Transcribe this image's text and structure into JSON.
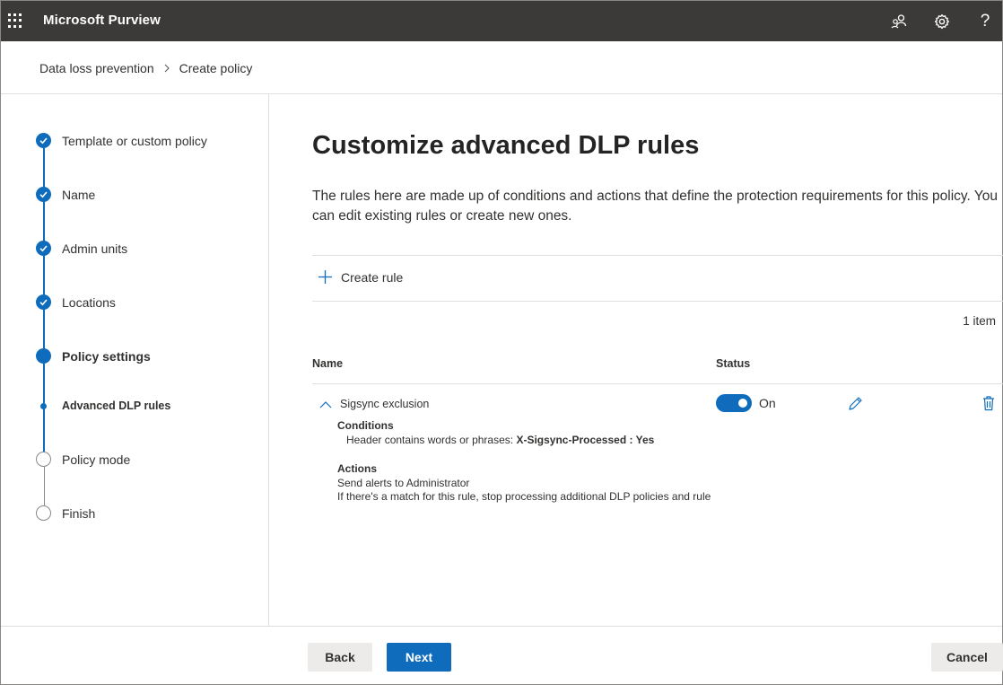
{
  "app": {
    "title": "Microsoft Purview"
  },
  "topbar_icons": [
    "waffle-icon",
    "community-icon",
    "gear-icon",
    "help-icon"
  ],
  "help_glyph": "?",
  "breadcrumb": {
    "items": [
      "Data loss prevention",
      "Create policy"
    ]
  },
  "steps": [
    {
      "label": "Template or custom policy",
      "state": "done"
    },
    {
      "label": "Name",
      "state": "done"
    },
    {
      "label": "Admin units",
      "state": "done"
    },
    {
      "label": "Locations",
      "state": "done"
    },
    {
      "label": "Policy settings",
      "state": "current"
    },
    {
      "label": "Advanced DLP rules",
      "state": "current-sub"
    },
    {
      "label": "Policy mode",
      "state": "todo"
    },
    {
      "label": "Finish",
      "state": "todo"
    }
  ],
  "main": {
    "title": "Customize advanced DLP rules",
    "description": "The rules here are made up of conditions and actions that define the protection requirements for this policy. You can edit existing rules or create new ones.",
    "create_rule_label": "Create rule",
    "item_count": "1 item",
    "columns": {
      "name": "Name",
      "status": "Status"
    },
    "rule": {
      "name": "Sigsync exclusion",
      "conditions_heading": "Conditions",
      "condition_prefix": "Header contains words or phrases: ",
      "condition_value": "X-Sigsync-Processed : Yes",
      "actions_heading": "Actions",
      "action_1": "Send alerts to Administrator",
      "action_2": "If there's a match for this rule, stop processing additional DLP policies and rule",
      "status_label": "On",
      "enabled": true
    }
  },
  "footer": {
    "back": "Back",
    "next": "Next",
    "cancel": "Cancel"
  },
  "colors": {
    "accent": "#0f6cbd",
    "topbar": "#3b3a39"
  }
}
